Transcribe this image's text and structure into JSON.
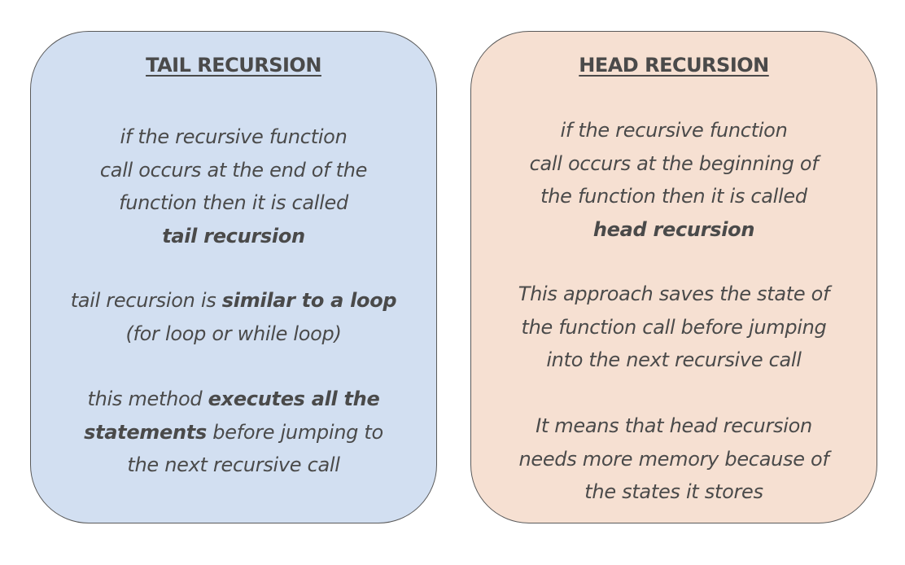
{
  "tail": {
    "title": "TAIL RECURSION",
    "para1": {
      "l1": "if the recursive function",
      "l2": "call occurs at the end of the",
      "l3": "function then it is called",
      "l4": "tail recursion"
    },
    "para2": {
      "l1_plain": "tail recursion is ",
      "l1_bold": "similar to a loop",
      "l2": "(for loop or while loop)"
    },
    "para3": {
      "l1_plain": "this method ",
      "l1_bold": "executes all the",
      "l2_bold": "statements",
      "l2_plain": " before jumping to",
      "l3": "the next recursive call"
    }
  },
  "head": {
    "title": "HEAD RECURSION",
    "para1": {
      "l1": "if the recursive function",
      "l2": "call occurs at the beginning of",
      "l3": "the function then it is called",
      "l4": "head recursion"
    },
    "para2": {
      "l1": "This approach saves the state of",
      "l2": "the function call before jumping",
      "l3": "into the next recursive call"
    },
    "para3": {
      "l1": "It means that head recursion",
      "l2": "needs more memory because of",
      "l3": "the states it stores"
    }
  },
  "colors": {
    "tail_card_bg": "#d2dff1",
    "head_card_bg": "#f6e0d2",
    "text": "#4a4a4a",
    "border": "#5a5a5a"
  }
}
